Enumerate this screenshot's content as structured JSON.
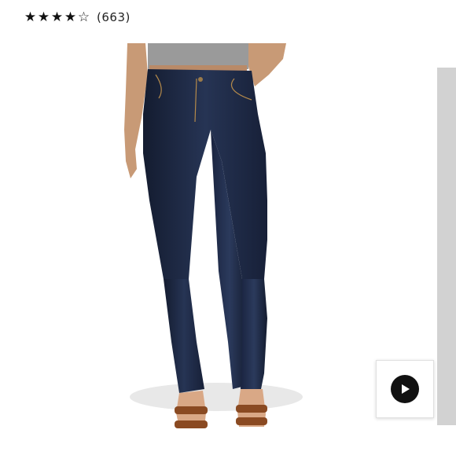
{
  "rating": {
    "value": 4,
    "max": 5,
    "stars": [
      {
        "glyph": "★",
        "filled": true
      },
      {
        "glyph": "★",
        "filled": true
      },
      {
        "glyph": "★",
        "filled": true
      },
      {
        "glyph": "★",
        "filled": true
      },
      {
        "glyph": "☆",
        "filled": false
      }
    ],
    "count_label": "(663)"
  },
  "product_image": {
    "icon": "jeans-photo"
  },
  "video": {
    "icon": "play-icon"
  },
  "colors": {
    "denim": "#1e2a44",
    "scrollbar": "#d2d2d2",
    "play": "#111111"
  }
}
